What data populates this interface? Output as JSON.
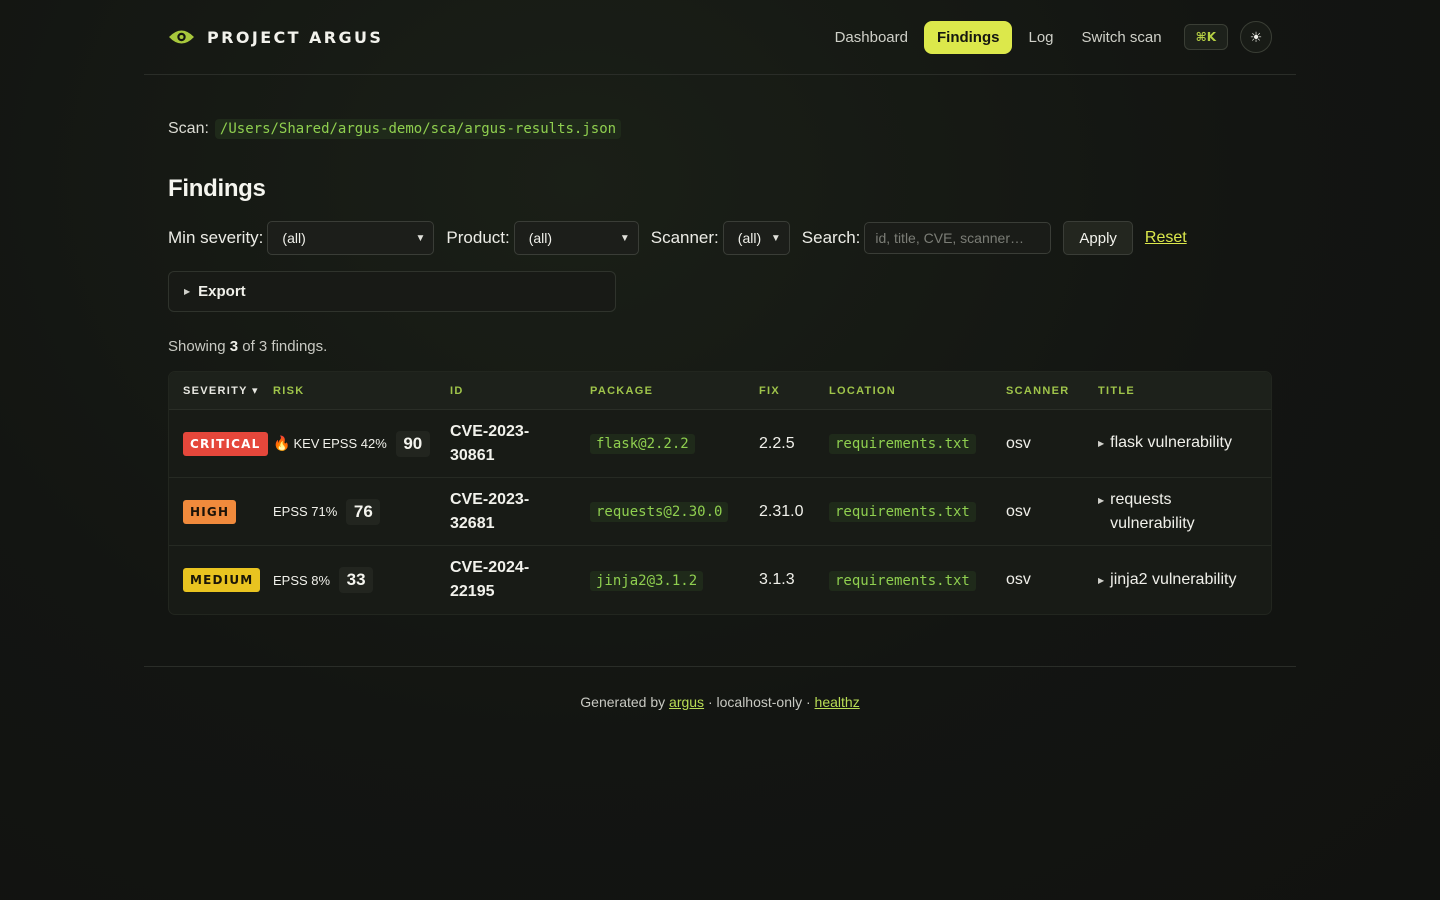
{
  "brand": {
    "name": "PROJECT ARGUS",
    "logo_icon": "eye-icon",
    "accent": "#dce84b"
  },
  "nav": {
    "items": [
      {
        "label": "Dashboard",
        "active": false
      },
      {
        "label": "Findings",
        "active": true
      },
      {
        "label": "Log",
        "active": false
      },
      {
        "label": "Switch scan",
        "active": false
      }
    ],
    "shortcut": "⌘K",
    "theme_icon": "sun-icon"
  },
  "scan": {
    "label": "Scan:",
    "path": "/Users/Shared/argus-demo/sca/argus-results.json"
  },
  "page_title": "Findings",
  "filters": {
    "min_severity": {
      "label": "Min severity:",
      "value": "(all)"
    },
    "product": {
      "label": "Product:",
      "value": "(all)"
    },
    "scanner": {
      "label": "Scanner:",
      "value": "(all)"
    },
    "search": {
      "label": "Search:",
      "placeholder": "id, title, CVE, scanner…",
      "value": ""
    },
    "apply_label": "Apply",
    "reset_label": "Reset"
  },
  "export": {
    "label": "Export"
  },
  "summary": {
    "prefix": "Showing",
    "shown": "3",
    "middle": "of 3 findings."
  },
  "table": {
    "headers": {
      "severity": "SEVERITY ▾",
      "risk": "RISK",
      "id": "ID",
      "package": "PACKAGE",
      "fix": "FIX",
      "location": "LOCATION",
      "scanner": "SCANNER",
      "title": "TITLE"
    },
    "rows": [
      {
        "severity": "CRITICAL",
        "severity_color": "#e5473b",
        "severity_text_color": "#ffffff",
        "kev": true,
        "kev_label": "KEV",
        "epss": "EPSS 42%",
        "score": "90",
        "id": "CVE-2023-30861",
        "package": "flask@2.2.2",
        "fix": "2.2.5",
        "location": "requirements.txt",
        "scanner": "osv",
        "title": "flask vulnerability"
      },
      {
        "severity": "HIGH",
        "severity_color": "#f08a3c",
        "severity_text_color": "#1a1208",
        "kev": false,
        "kev_label": "",
        "epss": "EPSS 71%",
        "score": "76",
        "id": "CVE-2023-32681",
        "package": "requests@2.30.0",
        "fix": "2.31.0",
        "location": "requirements.txt",
        "scanner": "osv",
        "title": "requests vulnerability"
      },
      {
        "severity": "MEDIUM",
        "severity_color": "#e9c420",
        "severity_text_color": "#1a1608",
        "kev": false,
        "kev_label": "",
        "epss": "EPSS 8%",
        "score": "33",
        "id": "CVE-2024-22195",
        "package": "jinja2@3.1.2",
        "fix": "3.1.3",
        "location": "requirements.txt",
        "scanner": "osv",
        "title": "jinja2 vulnerability"
      }
    ]
  },
  "footer": {
    "prefix": "Generated by",
    "link1": "argus",
    "middle": "· localhost-only ·",
    "link2": "healthz"
  }
}
